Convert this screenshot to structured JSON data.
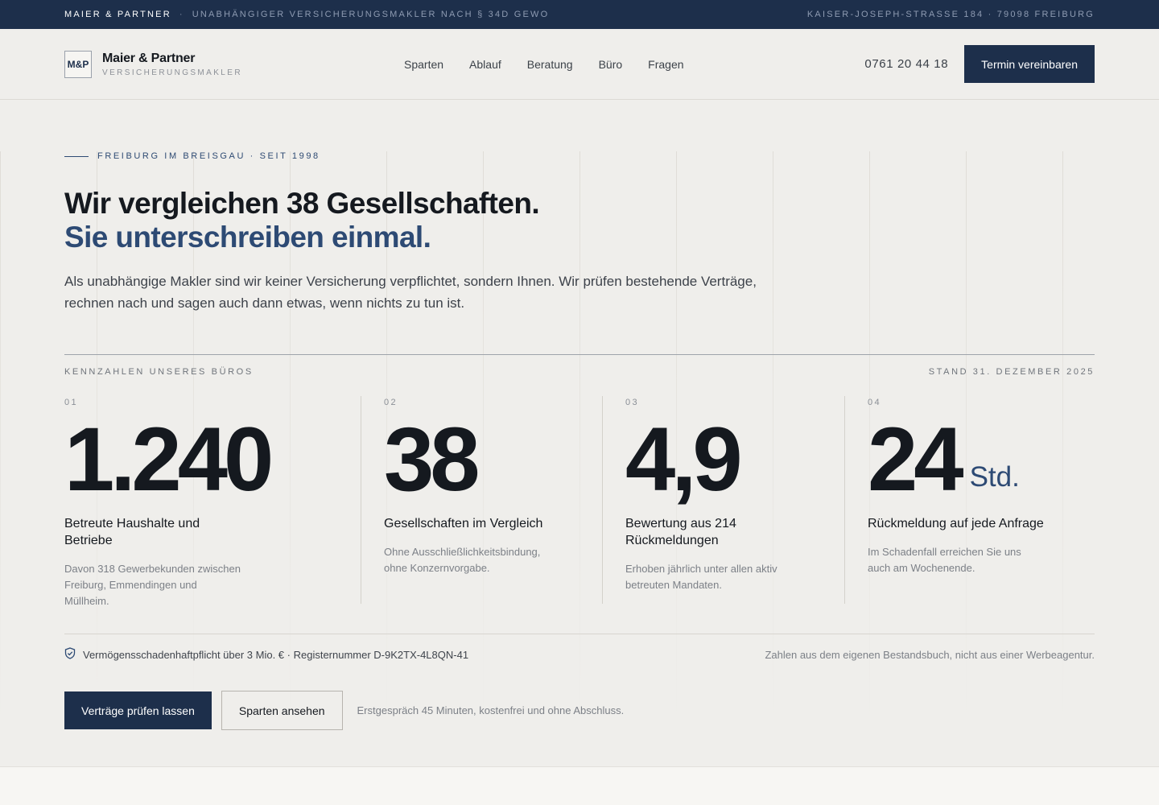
{
  "topbar": {
    "brand": "MAIER & PARTNER",
    "separator": "·",
    "tagline": "UNABHÄNGIGER VERSICHERUNGSMAKLER NACH § 34D GEWO",
    "address": "KAISER-JOSEPH-STRASSE 184 · 79098 FREIBURG"
  },
  "header": {
    "logo_mark": "M&P",
    "logo_name": "Maier & Partner",
    "logo_sub": "VERSICHERUNGSMAKLER",
    "nav": [
      "Sparten",
      "Ablauf",
      "Beratung",
      "Büro",
      "Fragen"
    ],
    "phone": "0761 20 44 18",
    "cta": "Termin vereinbaren"
  },
  "hero": {
    "eyebrow": "FREIBURG IM BREISGAU · SEIT 1998",
    "headline_1": "Wir vergleichen 38 Gesellschaften.",
    "headline_2": "Sie unterschreiben einmal.",
    "lead": "Als unabhängige Makler sind wir keiner Versicherung verpflichtet, sondern Ihnen. Wir prüfen bestehende Verträge, rechnen nach und sagen auch dann etwas, wenn nichts zu tun ist."
  },
  "stats": {
    "heading": "KENNZAHLEN UNSERES BÜROS",
    "as_of": "STAND 31. DEZEMBER 2025",
    "items": [
      {
        "index": "01",
        "value": "1.240",
        "unit": "",
        "title": "Betreute Haushalte und Betriebe",
        "desc": "Davon 318 Gewerbekunden zwischen Freiburg, Emmendingen und Müllheim."
      },
      {
        "index": "02",
        "value": "38",
        "unit": "",
        "title": "Gesellschaften im Vergleich",
        "desc": "Ohne Ausschließlichkeitsbindung, ohne Konzernvorgabe."
      },
      {
        "index": "03",
        "value": "4,9",
        "unit": "",
        "title": "Bewertung aus 214 Rückmeldungen",
        "desc": "Erhoben jährlich unter allen aktiv betreuten Mandaten."
      },
      {
        "index": "04",
        "value": "24",
        "unit": "Std.",
        "title": "Rückmeldung auf jede Anfrage",
        "desc": "Im Schadenfall erreichen Sie uns auch am Wochenende."
      }
    ]
  },
  "trust": {
    "icon": "shield-check-icon",
    "text": "Vermögensschadenhaftpflicht über 3 Mio. € · Registernummer D-9K2TX-4L8QN-41",
    "note": "Zahlen aus dem eigenen Bestandsbuch, nicht aus einer Werbeagentur."
  },
  "cta": {
    "primary": "Verträge prüfen lassen",
    "secondary": "Sparten ansehen",
    "note": "Erstgespräch 45 Minuten, kostenfrei und ohne Abschluss."
  },
  "colors": {
    "navy": "#1d2f4b",
    "accent_blue": "#2d4a74",
    "background": "#efeeeb"
  }
}
